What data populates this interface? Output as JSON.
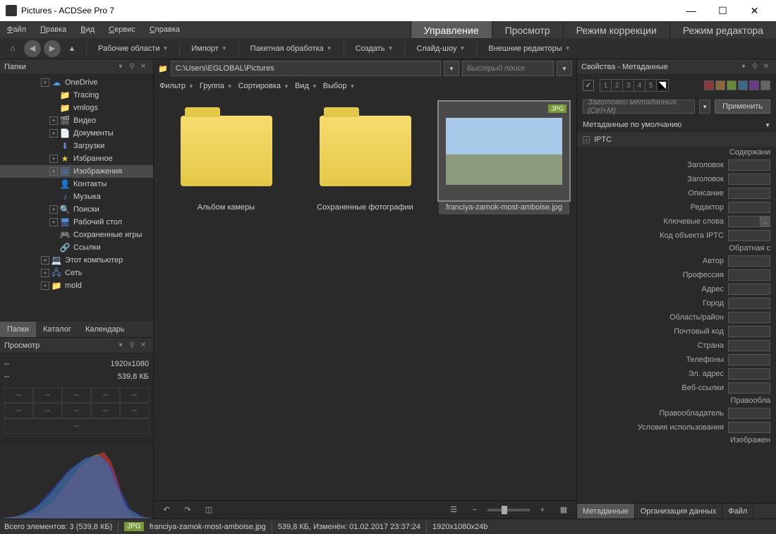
{
  "window": {
    "title": "Pictures - ACDSee Pro 7"
  },
  "menubar": {
    "items": [
      "Файл",
      "Правка",
      "Вид",
      "Сервис",
      "Справка"
    ],
    "modes": [
      "Управление",
      "Просмотр",
      "Режим коррекции",
      "Режим редактора"
    ],
    "active_mode": 0
  },
  "toolbar": {
    "dropdowns": [
      "Рабочие области",
      "Импорт",
      "Пакетная обработка",
      "Создать",
      "Слайд-шоу",
      "Внешние редакторы"
    ]
  },
  "folders_panel": {
    "title": "Папки",
    "tabs": [
      "Папки",
      "Каталог",
      "Календарь"
    ],
    "active_tab": 0,
    "tree": [
      {
        "label": "OneDrive",
        "icon": "☁",
        "color": "#4aa3df",
        "indent": 1,
        "exp": "+"
      },
      {
        "label": "Tracing",
        "icon": "📁",
        "color": "#e3c847",
        "indent": 2,
        "exp": ""
      },
      {
        "label": "vmlogs",
        "icon": "📁",
        "color": "#e3c847",
        "indent": 2,
        "exp": ""
      },
      {
        "label": "Видео",
        "icon": "🎬",
        "color": "#5a8ad4",
        "indent": 2,
        "exp": "+"
      },
      {
        "label": "Документы",
        "icon": "📄",
        "color": "#5a8ad4",
        "indent": 2,
        "exp": "+"
      },
      {
        "label": "Загрузки",
        "icon": "⬇",
        "color": "#5a8ad4",
        "indent": 2,
        "exp": ""
      },
      {
        "label": "Избранное",
        "icon": "★",
        "color": "#e3c847",
        "indent": 2,
        "exp": "+"
      },
      {
        "label": "Изображения",
        "icon": "🖼",
        "color": "#5a8ad4",
        "indent": 2,
        "exp": "+",
        "selected": true
      },
      {
        "label": "Контакты",
        "icon": "👤",
        "color": "#5a8ad4",
        "indent": 2,
        "exp": ""
      },
      {
        "label": "Музыка",
        "icon": "♪",
        "color": "#5a8ad4",
        "indent": 2,
        "exp": ""
      },
      {
        "label": "Поиски",
        "icon": "🔍",
        "color": "#5a8ad4",
        "indent": 2,
        "exp": "+"
      },
      {
        "label": "Рабочий стол",
        "icon": "🖥",
        "color": "#5a8ad4",
        "indent": 2,
        "exp": "+"
      },
      {
        "label": "Сохраненные игры",
        "icon": "🎮",
        "color": "#5a8ad4",
        "indent": 2,
        "exp": ""
      },
      {
        "label": "Ссылки",
        "icon": "🔗",
        "color": "#5a8ad4",
        "indent": 2,
        "exp": ""
      },
      {
        "label": "Этот компьютер",
        "icon": "💻",
        "color": "#5a8ad4",
        "indent": 1,
        "exp": "+"
      },
      {
        "label": "Сеть",
        "icon": "🖧",
        "color": "#5a8ad4",
        "indent": 1,
        "exp": "+"
      },
      {
        "label": "mold",
        "icon": "📁",
        "color": "#e3c847",
        "indent": 1,
        "exp": "+"
      }
    ]
  },
  "preview_panel": {
    "title": "Просмотр",
    "info": {
      "dash": "--",
      "dimensions": "1920x1080",
      "size": "539,8 КБ"
    }
  },
  "pathbar": {
    "path": "C:\\Users\\EGLOBAL\\Pictures",
    "search_placeholder": "Быстрый поиск"
  },
  "filterbar": {
    "items": [
      "Фильтр",
      "Группа",
      "Сортировка",
      "Вид",
      "Выбор"
    ]
  },
  "thumbnails": [
    {
      "label": "Альбом камеры",
      "type": "folder"
    },
    {
      "label": "Сохраненные фотографии",
      "type": "folder"
    },
    {
      "label": "franciya-zamok-most-amboise.jpg",
      "type": "image",
      "badge": "JPG",
      "selected": true
    }
  ],
  "properties_panel": {
    "title": "Свойства - Метаданные",
    "preset_placeholder": "Заготовки метаданных (Ctrl+M)",
    "apply": "Применить",
    "default_label": "Метаданные по умолчанию",
    "section": "IPTC",
    "fields": [
      "Содержани",
      "Заголовок",
      "Заголовок",
      "Описание",
      "Редактор",
      "Ключевые слова",
      "Код объекта IPTC",
      "Обратная с",
      "Автор",
      "Профессия",
      "Адрес",
      "Город",
      "Область/район",
      "Почтовый код",
      "Страна",
      "Телефоны",
      "Эл. адрес",
      "Веб-ссылки",
      "Правообла",
      "Правообладатель",
      "Условия использования",
      "Изображен"
    ],
    "subheads": {
      "0": true,
      "7": true,
      "18": true,
      "21": true
    },
    "keywords_btn": {
      "5": true
    },
    "tabs": [
      "Метаданные",
      "Организация данных",
      "Файл"
    ],
    "active_tab": 0,
    "rating_numbers": [
      "1",
      "2",
      "3",
      "4",
      "5"
    ],
    "swatch_colors": [
      "#8a3a3a",
      "#8a6a3a",
      "#6a8a3a",
      "#3a6a8a",
      "#6a3a8a",
      "#666"
    ]
  },
  "statusbar": {
    "total": "Всего элементов: 3  (539,8 КБ)",
    "badge": "JPG",
    "filename": "franciya-zamok-most-amboise.jpg",
    "info": "539,8 КБ,  Изменён: 01.02.2017 23:37:24",
    "dims": "1920x1080x24b"
  }
}
